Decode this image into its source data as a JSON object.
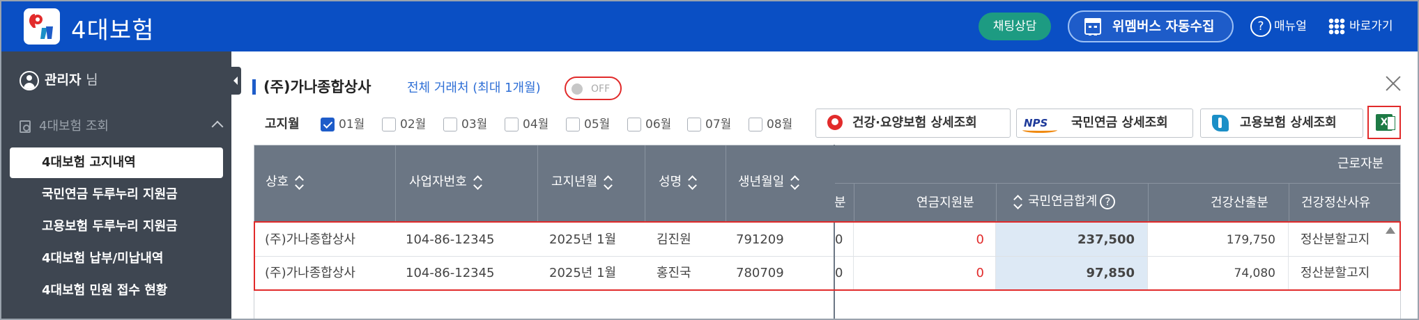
{
  "header": {
    "app_title": "4대보험",
    "chat_label": "채팅상담",
    "collect_label": "위멤버스 자동수집",
    "manual_label": "매뉴얼",
    "shortcut_label": "바로가기"
  },
  "sidebar": {
    "user_name": "관리자",
    "user_suffix": "님",
    "group_label": "4대보험 조회",
    "items": [
      {
        "label": "4대보험 고지내역",
        "active": true
      },
      {
        "label": "국민연금 두루누리 지원금",
        "active": false
      },
      {
        "label": "고용보험 두루누리 지원금",
        "active": false
      },
      {
        "label": "4대보험 납부/미납내역",
        "active": false
      },
      {
        "label": "4대보험 민원 접수 현황",
        "active": false
      }
    ]
  },
  "main": {
    "company": "(주)가나종합상사",
    "all_clients": "전체 거래처 (최대 1개월)",
    "toggle_state": "OFF",
    "month_label": "고지월",
    "months": [
      {
        "label": "01월",
        "checked": true
      },
      {
        "label": "02월",
        "checked": false
      },
      {
        "label": "03월",
        "checked": false
      },
      {
        "label": "04월",
        "checked": false
      },
      {
        "label": "05월",
        "checked": false
      },
      {
        "label": "06월",
        "checked": false
      },
      {
        "label": "07월",
        "checked": false
      },
      {
        "label": "08월",
        "checked": false
      }
    ],
    "buttons": {
      "health": "건강·요양보험 상세조회",
      "pension": "국민연금 상세조회",
      "employment": "고용보험 상세조회",
      "nps_logo": "NPS"
    }
  },
  "table": {
    "group_header": "근로자분",
    "headers_left": [
      "상호",
      "사업자번호",
      "고지년월",
      "성명",
      "생년월일"
    ],
    "headers_right": [
      "분",
      "연금지원분",
      "국민연금합계",
      "건강산출분",
      "건강정산사유"
    ],
    "rows": [
      {
        "company": "(주)가나종합상사",
        "biz_no": "104-86-12345",
        "notice_month": "2025년 1월",
        "name": "김진원",
        "birth": "791209",
        "partial": "0",
        "pension_support": "0",
        "pension_total": "237,500",
        "health_calc": "179,750",
        "health_reason": "정산분할고지"
      },
      {
        "company": "(주)가나종합상사",
        "biz_no": "104-86-12345",
        "notice_month": "2025년 1월",
        "name": "홍진국",
        "birth": "780709",
        "partial": "0",
        "pension_support": "0",
        "pension_total": "97,850",
        "health_calc": "74,080",
        "health_reason": "정산분할고지"
      }
    ]
  },
  "colors": {
    "brand_blue": "#0a4fc4",
    "chat_green": "#1d9b82",
    "sidebar_bg": "#3e4651",
    "header_gray": "#6b7684",
    "highlight_red": "#e12a2a",
    "highlight_col": "#dde9f5"
  },
  "icons": {
    "logo": "nps-logo-icon",
    "calendar": "calendar-icon",
    "help": "help-circle-icon",
    "grid": "grid-icon",
    "user": "user-icon",
    "search_doc": "search-doc-icon",
    "close": "close-icon",
    "excel": "excel-icon"
  }
}
